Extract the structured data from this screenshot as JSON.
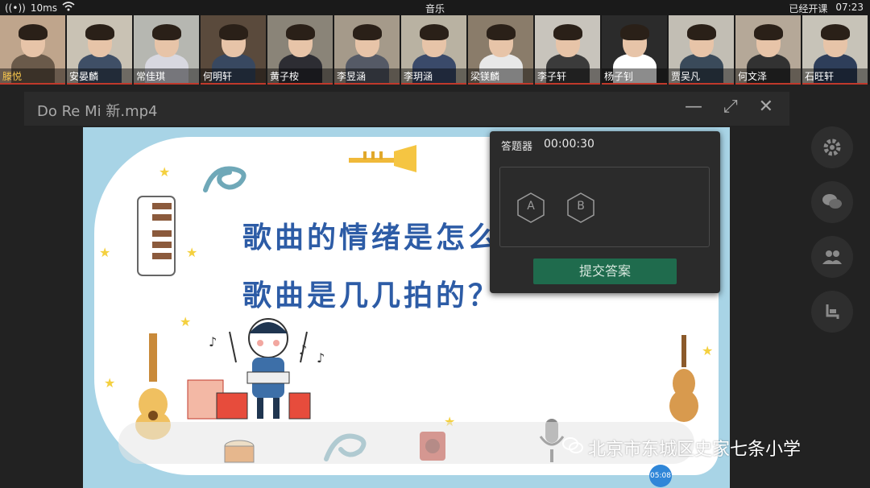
{
  "status": {
    "latency": "10ms",
    "title": "音乐",
    "elapsed_label": "已经开课",
    "clock": "07:23"
  },
  "participants": [
    {
      "name": "滕悦",
      "shirt": "#6a5a4a",
      "bg": "#bfa58c"
    },
    {
      "name": "安晏麟",
      "shirt": "#3f4f66",
      "bg": "#c9c2b4"
    },
    {
      "name": "常佳琪",
      "shirt": "#d8d8e0",
      "bg": "#b6b7b1"
    },
    {
      "name": "何明轩",
      "shirt": "#384860",
      "bg": "#5a4a3c"
    },
    {
      "name": "黄子桉",
      "shirt": "#2d2d33",
      "bg": "#8a8478"
    },
    {
      "name": "李昱涵",
      "shirt": "#555a66",
      "bg": "#a59a8a"
    },
    {
      "name": "李玥涵",
      "shirt": "#3a4a6a",
      "bg": "#b9b2a2"
    },
    {
      "name": "梁镁麟",
      "shirt": "#e8e8e8",
      "bg": "#8a7c6a"
    },
    {
      "name": "李子轩",
      "shirt": "#3b3b3b",
      "bg": "#c8c4bc"
    },
    {
      "name": "杨子钊",
      "shirt": "#ffffff",
      "bg": "#2b2b2b"
    },
    {
      "name": "贾吴凡",
      "shirt": "#3a4a5a",
      "bg": "#c2beb4"
    },
    {
      "name": "何文泽",
      "shirt": "#323232",
      "bg": "#b5a898"
    },
    {
      "name": "石旺轩",
      "shirt": "#2e3e5a",
      "bg": "#c7c3b8"
    }
  ],
  "window": {
    "title": "Do Re Mi 新.mp4"
  },
  "slide": {
    "question1": "歌曲的情绪是怎么",
    "question2": "歌曲是几几拍的？"
  },
  "answer_panel": {
    "title": "答题器",
    "timer": "00:00:30",
    "option_a": "A",
    "option_b": "B",
    "submit": "提交答案"
  },
  "watermark": "北京市东城区史家七条小学",
  "player": {
    "time": "05:08"
  },
  "colors": {
    "accent_green": "#1f6b4d",
    "slide_blue": "#2d5ca6",
    "slide_frame": "#a8d4e6"
  }
}
